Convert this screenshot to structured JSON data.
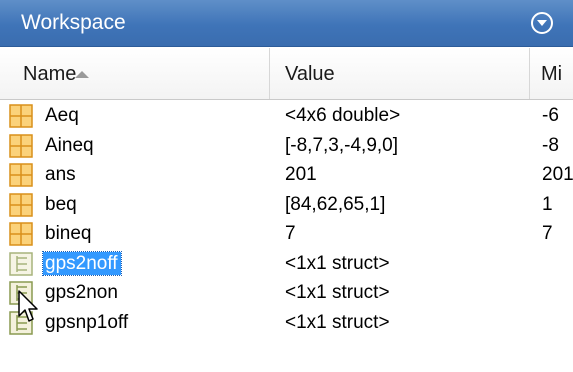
{
  "panel": {
    "title": "Workspace",
    "menu_icon": "chevron-down-circle-icon"
  },
  "columns": {
    "name": "Name",
    "value": "Value",
    "min": "Mi"
  },
  "colors": {
    "titlebar": "#3f74b8",
    "selection": "#3399ff",
    "matrix_icon": "#e8a21c",
    "struct_icon": "#8aa35a"
  },
  "variables": [
    {
      "name": "Aeq",
      "value": "<4x6 double>",
      "min": "-6",
      "icon": "matrix-icon"
    },
    {
      "name": "Aineq",
      "value": "[-8,7,3,-4,9,0]",
      "min": "-8",
      "icon": "matrix-icon"
    },
    {
      "name": "ans",
      "value": "201",
      "min": "201",
      "icon": "matrix-icon"
    },
    {
      "name": "beq",
      "value": "[84,62,65,1]",
      "min": "1",
      "icon": "matrix-icon"
    },
    {
      "name": "bineq",
      "value": "7",
      "min": "7",
      "icon": "matrix-icon"
    },
    {
      "name": "gps2noff",
      "value": "<1x1 struct>",
      "min": "",
      "icon": "struct-icon",
      "selected": true
    },
    {
      "name": "gps2non",
      "value": "<1x1 struct>",
      "min": "",
      "icon": "struct-icon"
    },
    {
      "name": "gpsnp1off",
      "value": "<1x1 struct>",
      "min": "",
      "icon": "struct-icon"
    }
  ]
}
